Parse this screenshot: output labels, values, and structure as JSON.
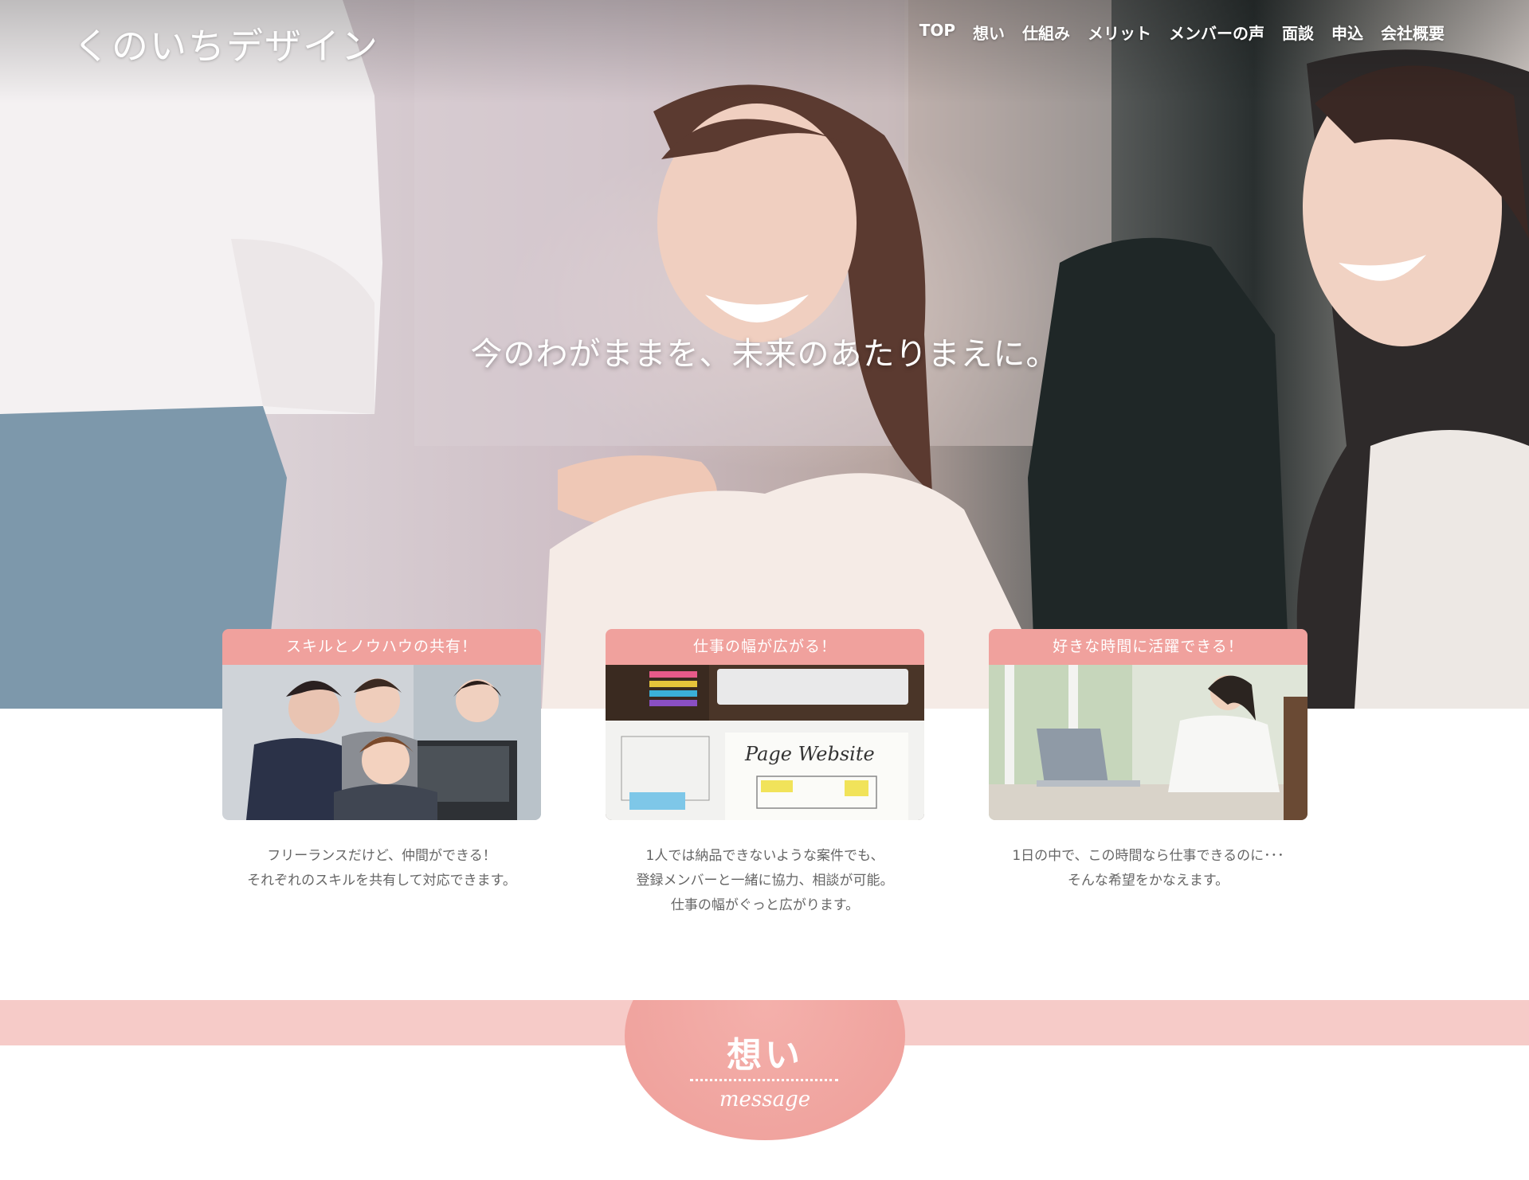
{
  "header": {
    "logo": "くのいちデザイン",
    "nav": [
      {
        "label": "TOP"
      },
      {
        "label": "想い"
      },
      {
        "label": "仕組み"
      },
      {
        "label": "メリット"
      },
      {
        "label": "メンバーの声"
      },
      {
        "label": "面談"
      },
      {
        "label": "申込"
      },
      {
        "label": "会社概要"
      }
    ]
  },
  "hero": {
    "catchphrase": "今のわがままを、未来のあたりまえに。"
  },
  "features": [
    {
      "title": "スキルとノウハウの共有！",
      "lines": [
        "フリーランスだけど、仲間ができる！",
        "それぞれのスキルを共有して対応できます。"
      ]
    },
    {
      "title": "仕事の幅が広がる！",
      "lines": [
        "1人では納品できないような案件でも、",
        "登録メンバーと一緒に協力、相談が可能。",
        "仕事の幅がぐっと広がります。"
      ],
      "image_text": "Page Website"
    },
    {
      "title": "好きな時間に活躍できる！",
      "lines": [
        "1日の中で、この時間なら仕事できるのに･･･",
        "そんな希望をかなえます。"
      ]
    }
  ],
  "section": {
    "title_jp": "想い",
    "title_en": "message"
  },
  "colors": {
    "accent": "#f0a19d",
    "band": "#f6cbc8",
    "text": "#666666"
  }
}
